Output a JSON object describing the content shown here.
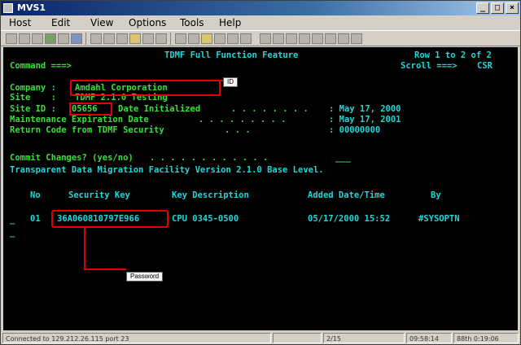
{
  "window": {
    "title": "MVS1"
  },
  "menu": [
    "Host",
    "Edit",
    "View",
    "Options",
    "Tools",
    "Help"
  ],
  "screen": {
    "header_title": "TDMF Full Function Feature",
    "row_indicator": "Row 1 to 2 of 2",
    "command_label": "Command ===>",
    "scroll_label": "Scroll ===>",
    "scroll_value": "CSR",
    "company_label": "Company :",
    "company_value": "Amdahl Corporation",
    "site_label": "Site    :",
    "site_value": "TDMF 2.1.0 Testing",
    "site_id_label": "Site ID :",
    "site_id_value": "05656",
    "date_init_label": "Date Initialized",
    "date_init_value": ": May 17, 2000",
    "maint_label": "Maintenance Expiration Date",
    "maint_value": ": May 17, 2001",
    "rc_label": "Return Code from TDMF Security",
    "rc_value": ": 00000000",
    "dots1": ". . . . . . . .",
    "dots2": ". . . . . . . . .",
    "dots3": ". . .",
    "commit_prompt": "Commit Changes? (yes/no)",
    "commit_dots": ". . . . . . . . . . . .",
    "version_line": "Transparent Data Migration Facility Version 2.1.0 Base Level.",
    "table_headers": {
      "no": "No",
      "key": "Security Key",
      "desc": "Key Description",
      "added": "Added Date/Time",
      "by": "By"
    },
    "rows": [
      {
        "sel": "_",
        "no": "01",
        "key": "36A060810797E966",
        "desc": "CPU 0345-0500",
        "added": "05/17/2000 15:52",
        "by": "#SYSOPTN"
      }
    ],
    "cursor_line": "_"
  },
  "annotations": {
    "id_label": "ID",
    "password_label": "Password"
  },
  "status": {
    "connected": "Connected to 129.212.26.115 port 23",
    "pos": "2/15",
    "time": "09:58:14",
    "extra": "88th 0:19:06"
  }
}
